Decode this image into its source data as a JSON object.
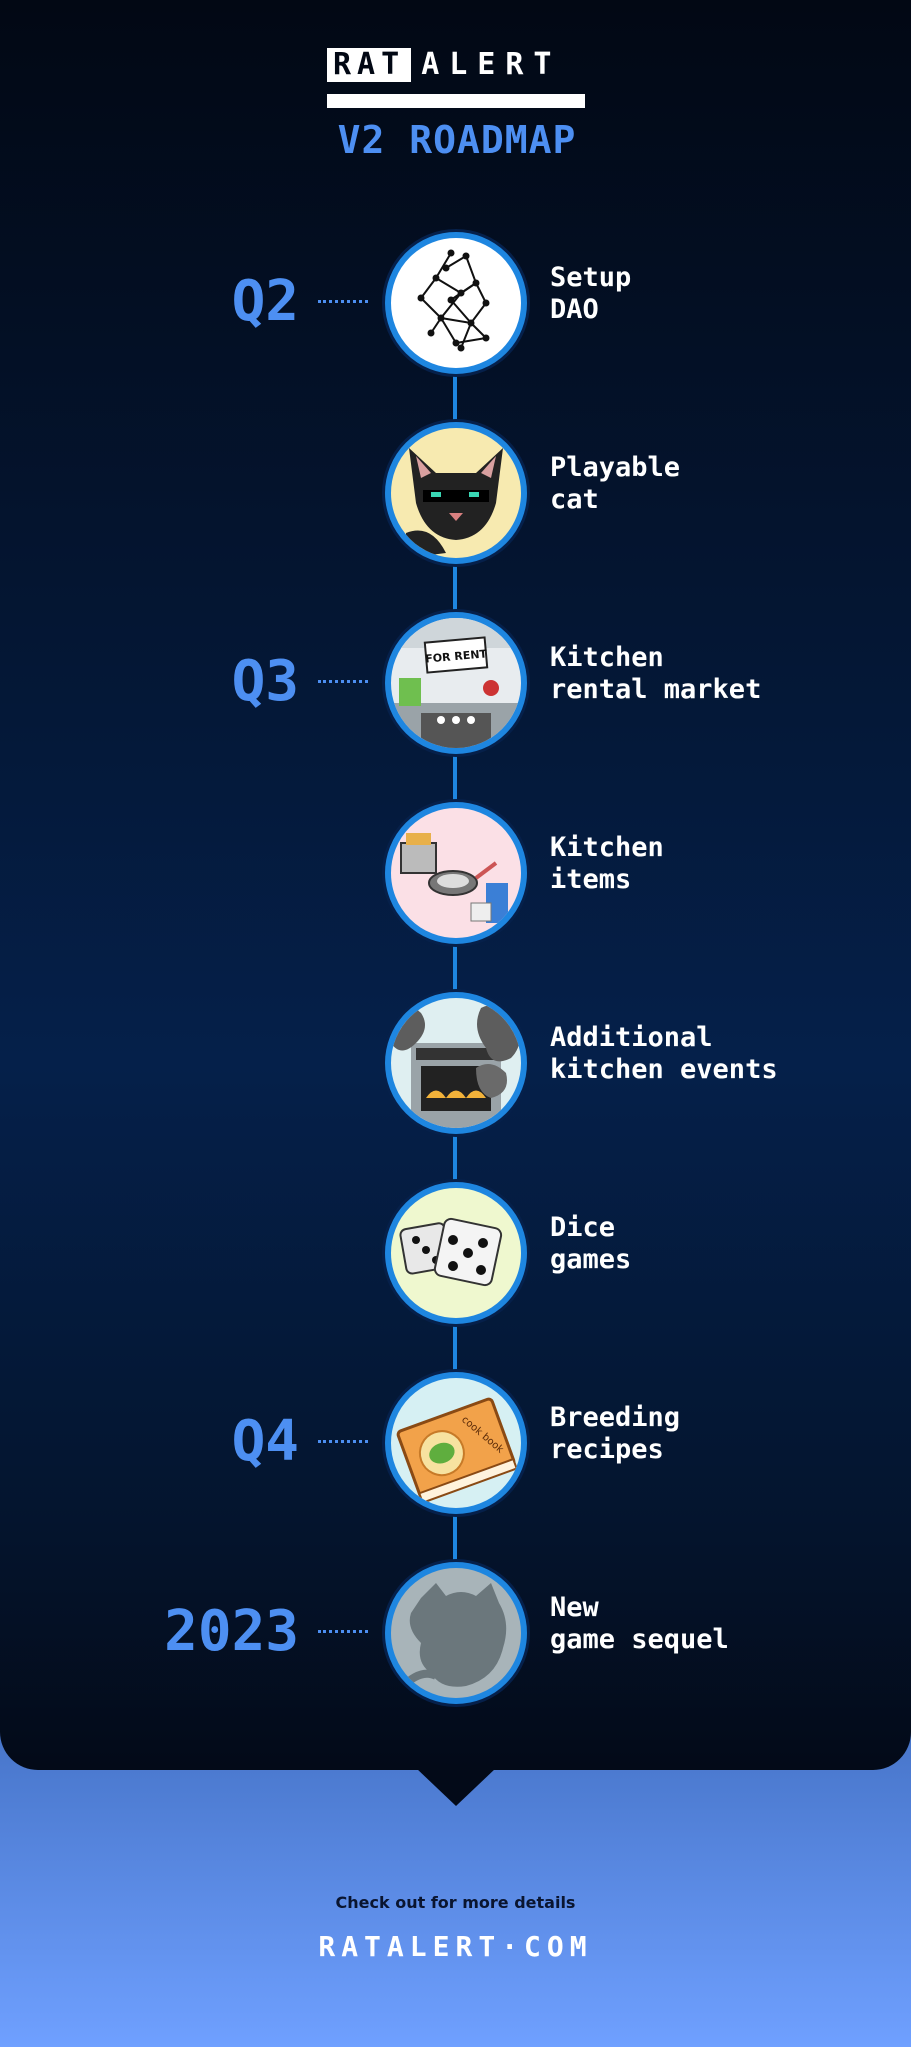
{
  "header": {
    "logo_block": "RAT",
    "logo_rest": "ALERT",
    "title": "V2 ROADMAP"
  },
  "roadmap": [
    {
      "quarter": "Q2",
      "line1": "Setup",
      "line2": "DAO",
      "icon": "network-icon",
      "bg": "#ffffff"
    },
    {
      "quarter": "",
      "line1": "Playable",
      "line2": "cat",
      "icon": "cat-icon",
      "bg": "#f7eab0"
    },
    {
      "quarter": "Q3",
      "line1": "Kitchen",
      "line2": "rental market",
      "icon": "for-rent-kitchen-icon",
      "bg": "#e8ecef",
      "sign": "FOR RENT"
    },
    {
      "quarter": "",
      "line1": "Kitchen",
      "line2": "items",
      "icon": "kitchen-items-icon",
      "bg": "#fbe0e6"
    },
    {
      "quarter": "",
      "line1": "Additional",
      "line2": "kitchen events",
      "icon": "oven-smoke-icon",
      "bg": "#dfeff1"
    },
    {
      "quarter": "",
      "line1": "Dice",
      "line2": "games",
      "icon": "dice-icon",
      "bg": "#eff8cf"
    },
    {
      "quarter": "Q4",
      "line1": "Breeding",
      "line2": "recipes",
      "icon": "cookbook-icon",
      "bg": "#d6f0f3",
      "book_text": "cook book"
    },
    {
      "quarter": "2023",
      "line1": "New",
      "line2": "game sequel",
      "icon": "rat-silhouette-icon",
      "bg": "#a8b4b9"
    }
  ],
  "footer": {
    "note": "Check out for more details",
    "url": "RATALERT·COM"
  },
  "colors": {
    "accent": "#4d8ff2",
    "ring": "#1e86e0",
    "panel": "#030a18"
  }
}
